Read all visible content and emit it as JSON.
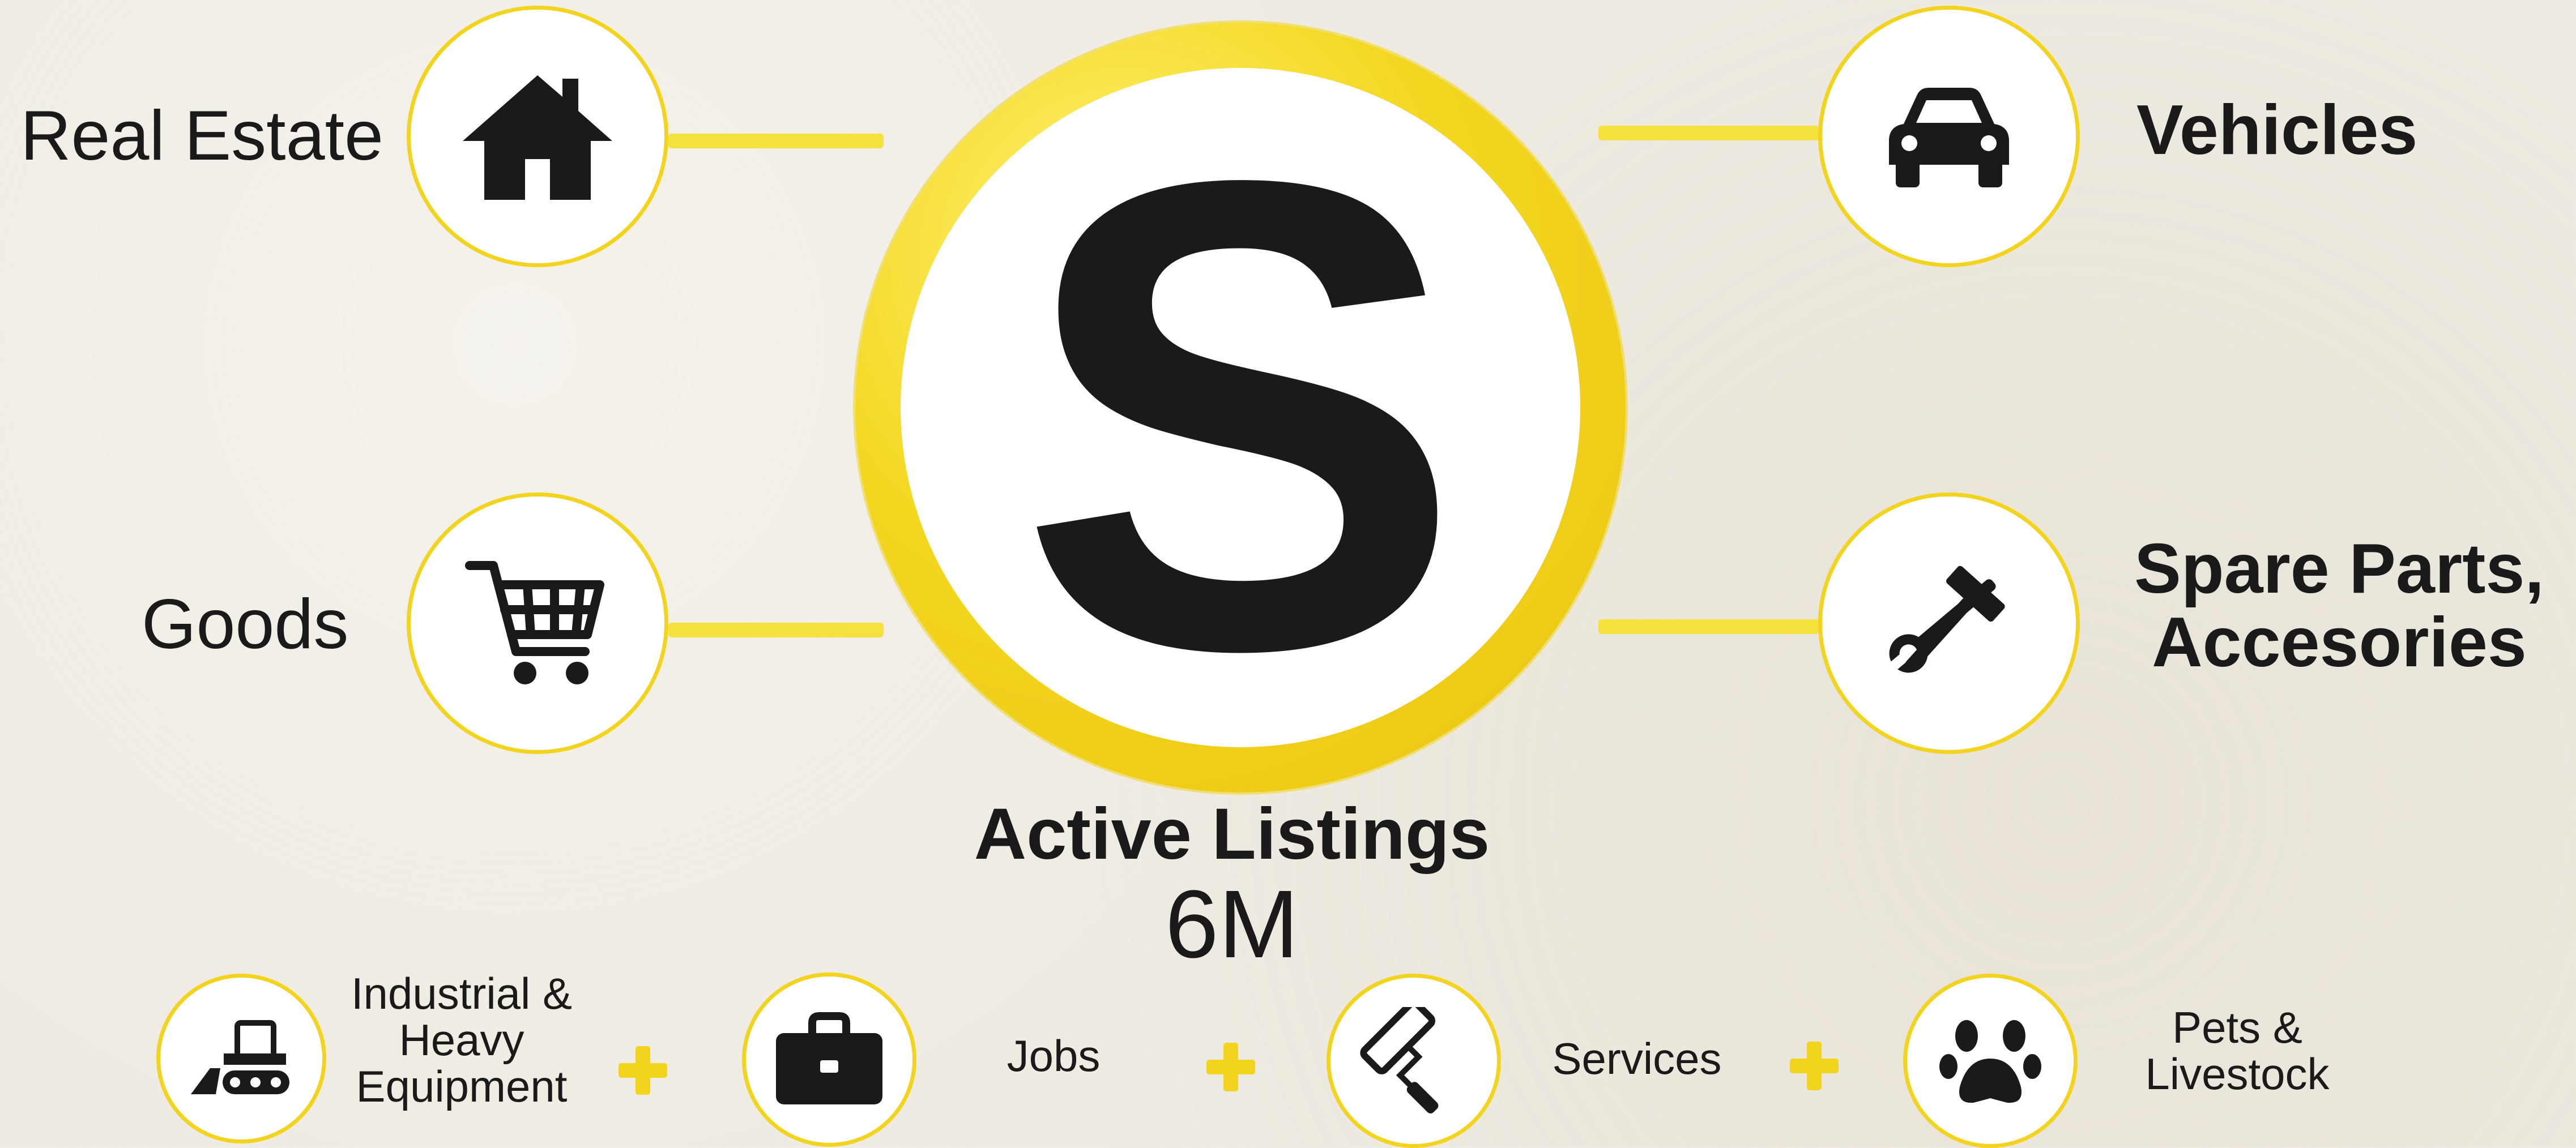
{
  "logo": {
    "letter": "S"
  },
  "categories": {
    "real_estate": {
      "label": "Real Estate",
      "icon": "house-icon"
    },
    "vehicles": {
      "label": "Vehicles",
      "icon": "car-icon"
    },
    "goods": {
      "label": "Goods",
      "icon": "shopping-cart-icon"
    },
    "spare_parts": {
      "label_line1": "Spare Parts,",
      "label_line2": "Accesories",
      "icon": "hammer-wrench-icon"
    }
  },
  "stats": {
    "title": "Active Listings",
    "value": "6M"
  },
  "bottom": [
    {
      "label_lines": [
        "Industrial &",
        "Heavy",
        "Equipment"
      ],
      "icon": "bulldozer-icon"
    },
    {
      "label_lines": [
        "Jobs"
      ],
      "icon": "briefcase-icon"
    },
    {
      "label_lines": [
        "Services"
      ],
      "icon": "paint-roller-icon"
    },
    {
      "label_lines": [
        "Pets &",
        "Livestock"
      ],
      "icon": "paw-icon"
    }
  ],
  "colors": {
    "accent": "#f2d41f",
    "background": "#efebe2",
    "text": "#1a1a1a"
  }
}
